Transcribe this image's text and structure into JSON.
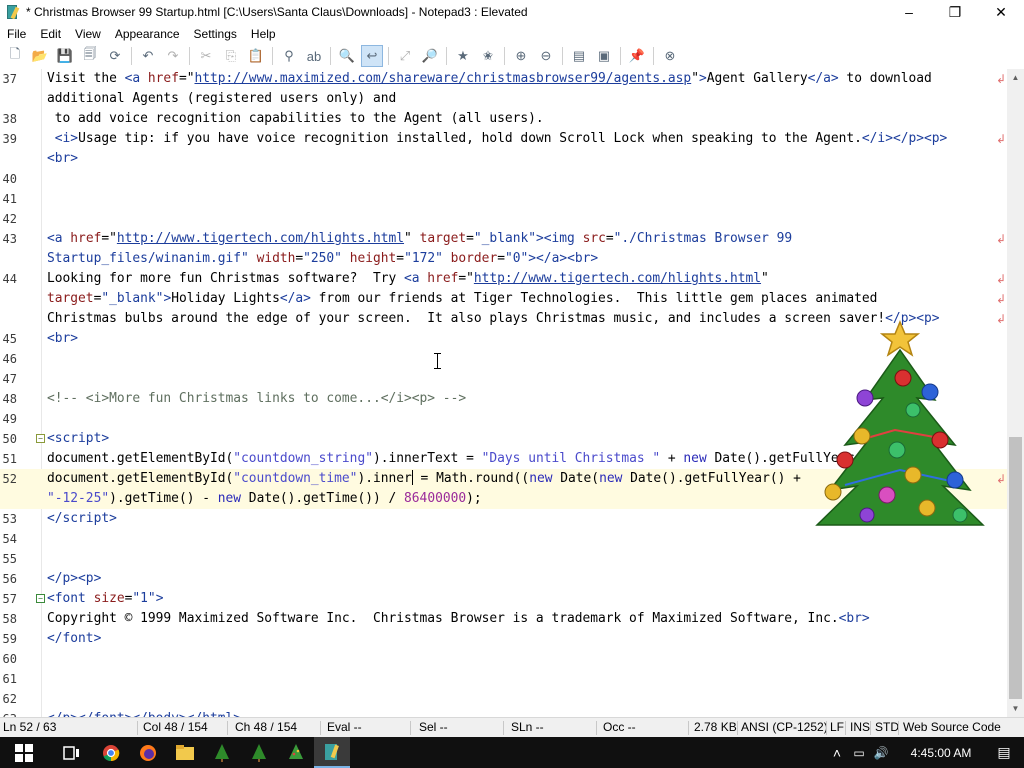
{
  "window": {
    "title": "* Christmas Browser 99 Startup.html [C:\\Users\\Santa Claus\\Downloads] - Notepad3 : Elevated",
    "icon": "notepad3-app-icon",
    "minimize_glyph": "–",
    "maximize_glyph": "❐",
    "close_glyph": "✕"
  },
  "menu": [
    "File",
    "Edit",
    "View",
    "Appearance",
    "Settings",
    "Help"
  ],
  "toolbar": {
    "buttons": [
      {
        "name": "new-file-icon",
        "glyph": "🗋"
      },
      {
        "name": "open-folder-icon",
        "glyph": "📂"
      },
      {
        "name": "save-icon",
        "glyph": "💾"
      },
      {
        "name": "save-as-icon",
        "glyph": "🗐"
      },
      {
        "name": "reload-icon",
        "glyph": "⟳"
      },
      {
        "sep": true
      },
      {
        "name": "undo-icon",
        "glyph": "↶"
      },
      {
        "name": "redo-icon",
        "glyph": "↷",
        "disabled": true
      },
      {
        "sep": true
      },
      {
        "name": "cut-icon",
        "glyph": "✂",
        "disabled": true
      },
      {
        "name": "copy-icon",
        "glyph": "⎘",
        "disabled": true
      },
      {
        "name": "paste-icon",
        "glyph": "📋"
      },
      {
        "sep": true
      },
      {
        "name": "find-icon",
        "glyph": "⚲"
      },
      {
        "name": "replace-icon",
        "glyph": "ab"
      },
      {
        "sep": true
      },
      {
        "name": "search-in-files-icon",
        "glyph": "🔍"
      },
      {
        "name": "word-wrap-icon",
        "glyph": "↩",
        "active": true
      },
      {
        "sep": true
      },
      {
        "name": "zoom-fit-icon",
        "glyph": "⤢",
        "disabled": true
      },
      {
        "name": "find-next-icon",
        "glyph": "🔎"
      },
      {
        "sep": true
      },
      {
        "name": "toggle-bookmark-icon",
        "glyph": "★"
      },
      {
        "name": "favorites-icon",
        "glyph": "✬"
      },
      {
        "sep": true
      },
      {
        "name": "zoom-in-icon",
        "glyph": "⊕"
      },
      {
        "name": "zoom-out-icon",
        "glyph": "⊖"
      },
      {
        "sep": true
      },
      {
        "name": "settings-dialog-icon",
        "glyph": "▤"
      },
      {
        "name": "screen-icon",
        "glyph": "▣"
      },
      {
        "sep": true
      },
      {
        "name": "pin-icon",
        "glyph": "📌"
      },
      {
        "sep": true
      },
      {
        "name": "exit-icon",
        "glyph": "⊗"
      }
    ]
  },
  "editor": {
    "current_line": 52,
    "rows": [
      {
        "ln": "37",
        "wrap": true,
        "html": "Visit the <span class=\"t\">&lt;a</span> <span class=\"a\">href</span>=\"<span class=\"u\">http://www.maximized.com/shareware/christmasbrowser99/agents.asp</span>\"<span class=\"t\">&gt;</span>Agent Gallery<span class=\"t\">&lt;/a&gt;</span> to download"
      },
      {
        "ln": "",
        "html": "additional Agents (registered users only) and"
      },
      {
        "ln": "38",
        "html": " to add voice recognition capabilities to the Agent (all users)."
      },
      {
        "ln": "39",
        "wrap": true,
        "html": " <span class=\"t\">&lt;i&gt;</span>Usage tip: if you have voice recognition installed, hold down Scroll Lock when speaking to the Agent.<span class=\"t\">&lt;/i&gt;&lt;/p&gt;&lt;p&gt;</span>"
      },
      {
        "ln": "",
        "html": "<span class=\"t\">&lt;br&gt;</span>"
      },
      {
        "ln": "40",
        "html": ""
      },
      {
        "ln": "41",
        "html": ""
      },
      {
        "ln": "42",
        "html": ""
      },
      {
        "ln": "43",
        "wrap": true,
        "html": "<span class=\"t\">&lt;a</span> <span class=\"a\">href</span>=\"<span class=\"u\">http://www.tigertech.com/hlights.html</span>\" <span class=\"a\">target</span>=<span class=\"s\">\"_blank\"</span><span class=\"t\">&gt;&lt;img</span> <span class=\"a\">src</span>=<span class=\"s\">\"./Christmas Browser 99</span>"
      },
      {
        "ln": "",
        "html": "<span class=\"s\">Startup_files/winanim.gif\"</span> <span class=\"a\">width</span>=<span class=\"s\">\"250\"</span> <span class=\"a\">height</span>=<span class=\"s\">\"172\"</span> <span class=\"a\">border</span>=<span class=\"s\">\"0\"</span><span class=\"t\">&gt;&lt;/a&gt;&lt;br&gt;</span>"
      },
      {
        "ln": "44",
        "wrap": true,
        "html": "Looking for more fun Christmas software?  Try <span class=\"t\">&lt;a</span> <span class=\"a\">href</span>=\"<span class=\"u\">http://www.tigertech.com/hlights.html</span>\""
      },
      {
        "ln": "",
        "wrap": true,
        "html": "<span class=\"a\">target</span>=<span class=\"s\">\"_blank\"</span><span class=\"t\">&gt;</span>Holiday Lights<span class=\"t\">&lt;/a&gt;</span> from our friends at Tiger Technologies.  This little gem places animated"
      },
      {
        "ln": "",
        "wrap": true,
        "html": "Christmas bulbs around the edge of your screen.  It also plays Christmas music, and includes a screen saver!<span class=\"t\">&lt;/p&gt;&lt;p&gt;</span>"
      },
      {
        "ln": "45",
        "html": "<span class=\"t\">&lt;br&gt;</span>"
      },
      {
        "ln": "46",
        "html": ""
      },
      {
        "ln": "47",
        "html": ""
      },
      {
        "ln": "48",
        "html": "<span class=\"c\">&lt;!-- &lt;i&gt;More fun Christmas links to come...&lt;/i&gt;&lt;p&gt; --&gt;</span>"
      },
      {
        "ln": "49",
        "html": ""
      },
      {
        "ln": "50",
        "fold": "−",
        "html": "<span class=\"t\">&lt;script&gt;</span>"
      },
      {
        "ln": "51",
        "html": "document.getElementById(<span class=\"str\">\"countdown_string\"</span>).innerText = <span class=\"str\">\"Days until Christmas \"</span> + <span class=\"kw\">new</span> Date().getFullYear();"
      },
      {
        "ln": "52",
        "current": true,
        "wrap": true,
        "html": "document.getElementById(<span class=\"str\">\"countdown_time\"</span>).inner<span class=\"caret\"></span> = Math.round((<span class=\"kw\">new</span> Date(<span class=\"kw\">new</span> Date().getFullYear() + "
      },
      {
        "ln": "",
        "current": true,
        "html": "<span class=\"str\">\"-12-25\"</span>).getTime() - <span class=\"kw\">new</span> Date().getTime()) / <span class=\"num\">86400000</span>);"
      },
      {
        "ln": "53",
        "html": "<span class=\"t\">&lt;/script&gt;</span>"
      },
      {
        "ln": "54",
        "html": ""
      },
      {
        "ln": "55",
        "html": ""
      },
      {
        "ln": "56",
        "html": "<span class=\"t\">&lt;/p&gt;&lt;p&gt;</span>"
      },
      {
        "ln": "57",
        "fold": "−",
        "foldGreen": true,
        "html": "<span class=\"t\">&lt;font</span> <span class=\"a\">size</span>=<span class=\"s\">\"1\"</span><span class=\"t\">&gt;</span>"
      },
      {
        "ln": "58",
        "html": "Copyright © 1999 Maximized Software Inc.  Christmas Browser is a trademark of Maximized Software, Inc.<span class=\"t\">&lt;br&gt;</span>"
      },
      {
        "ln": "59",
        "html": "<span class=\"t\">&lt;/font&gt;</span>"
      },
      {
        "ln": "60",
        "html": ""
      },
      {
        "ln": "61",
        "html": ""
      },
      {
        "ln": "62",
        "html": ""
      },
      {
        "ln": "63",
        "html": "<span class=\"t\">&lt;/p&gt;&lt;/font&gt;&lt;/body&gt;&lt;/html&gt;</span>"
      }
    ]
  },
  "status": {
    "ln": "Ln 52 / 63",
    "col": "Col 48 / 154",
    "ch": "Ch 48 / 154",
    "eval": "Eval --",
    "sel": "Sel --",
    "sln": "SLn --",
    "occ": "Occ --",
    "size": "2.78 KB",
    "encoding": "ANSI (CP-1252)",
    "eol": "LF",
    "ins": "INS",
    "std": "STD",
    "lexer": "Web Source Code"
  },
  "taskbar": {
    "apps": [
      "start-windows-icon",
      "task-view-icon",
      "chrome-icon",
      "firefox-icon",
      "file-explorer-icon",
      "christmas-tree-app-icon",
      "christmas-tree-app-icon-2",
      "christmas-tree-app-icon-3",
      "notepad3-taskbar-icon"
    ],
    "clock": "4:45:00 AM",
    "tray_up_glyph": "˄",
    "tray_net_glyph": "▭",
    "tray_vol_glyph": "🔊",
    "tray_notif_glyph": "▤"
  },
  "colors": {
    "tag": "#1c3d9c",
    "attribute": "#8a1b1b",
    "current_line": "#fffbe0",
    "comment": "#5f6f5f"
  }
}
